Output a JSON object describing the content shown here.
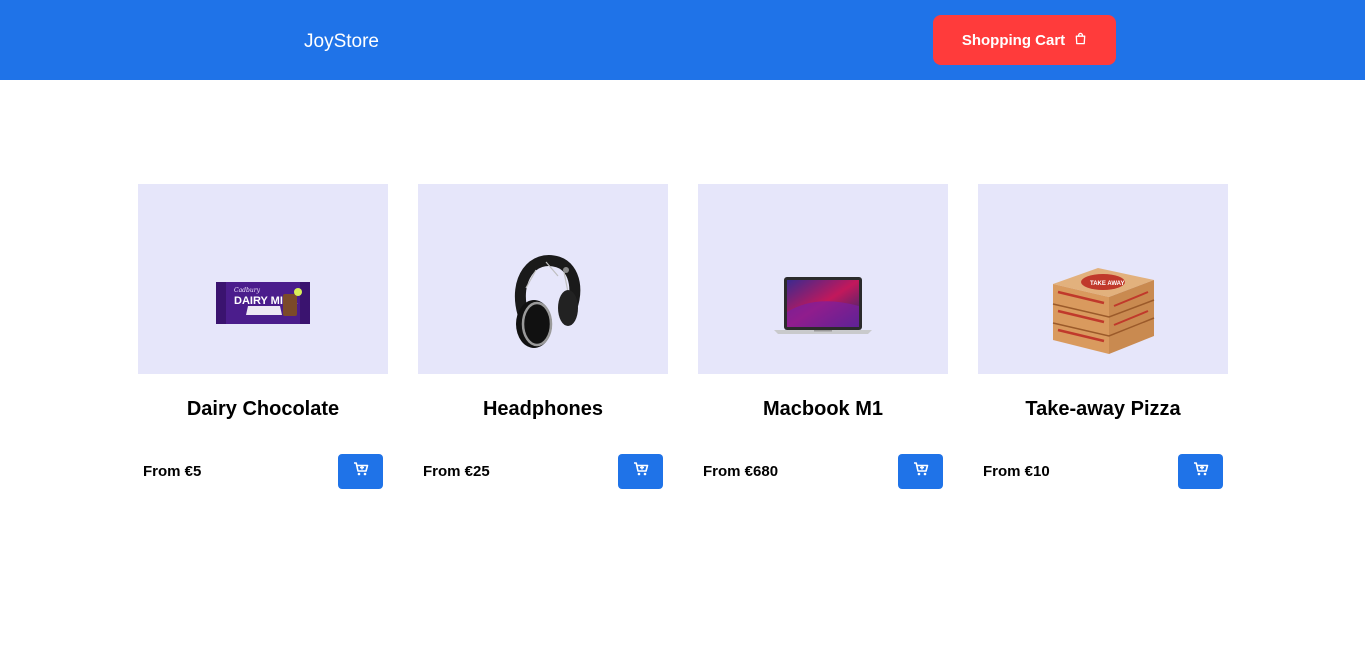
{
  "header": {
    "brand": "JoyStore",
    "cart_label": "Shopping Cart",
    "cart_icon": "shopping-bag-icon"
  },
  "colors": {
    "nav_bg": "#1f73e8",
    "cart_button_bg": "#ff3b3b",
    "card_image_bg": "#e6e6fa",
    "add_button_bg": "#1f73e8"
  },
  "products": [
    {
      "title": "Dairy Chocolate",
      "price": "From €5",
      "image": "chocolate-bar-image",
      "button_icon": "cart-plus-icon",
      "wrapper_text": "DAIRY MILK",
      "brand_text": "Cadbury"
    },
    {
      "title": "Headphones",
      "price": "From €25",
      "image": "headphones-image",
      "button_icon": "cart-plus-icon"
    },
    {
      "title": "Macbook M1",
      "price": "From €680",
      "image": "laptop-image",
      "button_icon": "cart-plus-icon"
    },
    {
      "title": "Take-away Pizza",
      "price": "From €10",
      "image": "pizza-boxes-image",
      "button_icon": "cart-plus-icon",
      "box_text": "TAKE AWAY"
    }
  ]
}
